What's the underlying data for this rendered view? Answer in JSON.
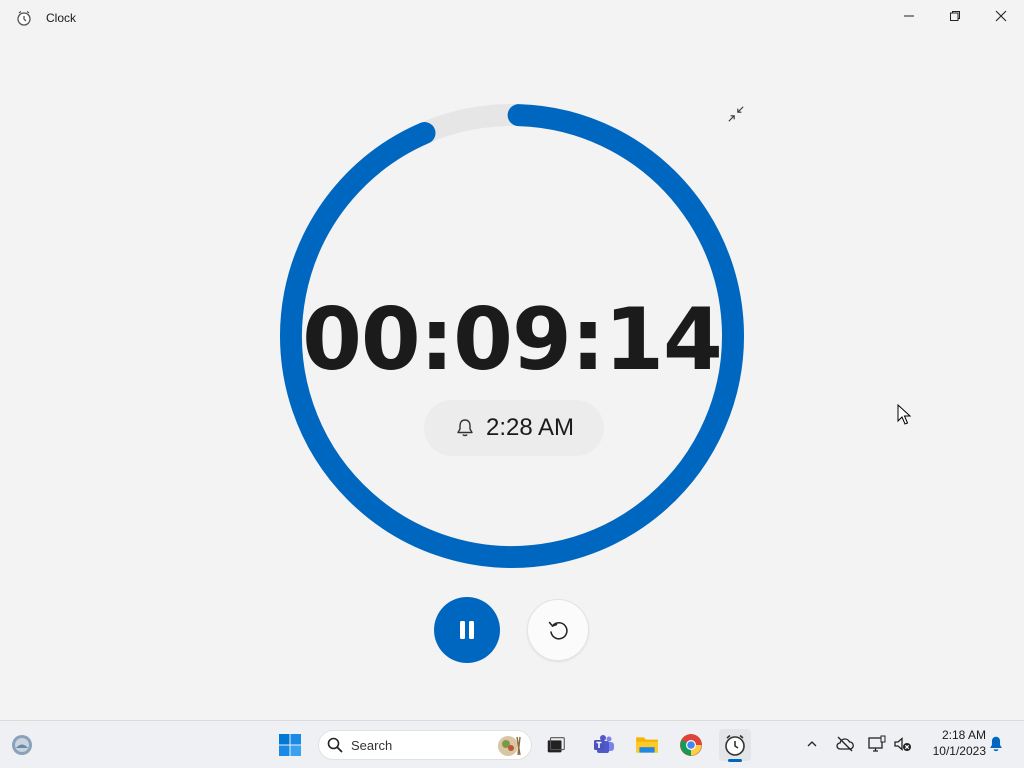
{
  "window": {
    "title": "Clock",
    "icons": {
      "app": "clock-app-icon",
      "minimize": "minimize-icon",
      "maximize": "restore-icon",
      "close": "close-icon"
    }
  },
  "timer": {
    "time": "00:09:14",
    "alarm_time": "2:28 AM",
    "progress_fraction": 0.94,
    "accent_color": "#0067c0",
    "track_color": "#e6e6e6"
  },
  "controls": {
    "pause_icon": "pause-icon",
    "reset_icon": "reset-icon",
    "compact_icon": "compact-overlay-icon"
  },
  "taskbar": {
    "search_label": "Search",
    "pinned": [
      "widgets-icon",
      "start-icon",
      "task-view-icon",
      "teams-icon",
      "file-explorer-icon",
      "chrome-icon",
      "clock-app-icon"
    ],
    "tray": {
      "time": "2:18 AM",
      "date": "10/1/2023"
    }
  }
}
